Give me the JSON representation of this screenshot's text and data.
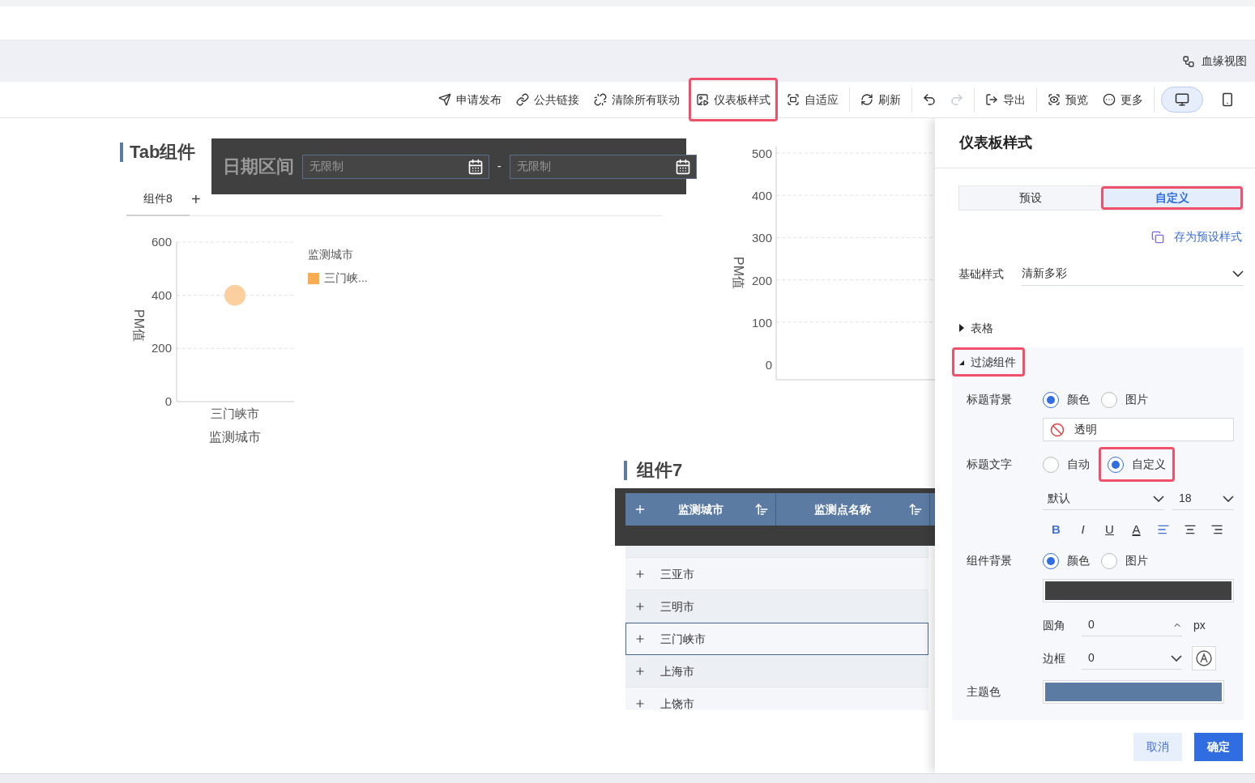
{
  "header": {
    "lineage_link": "血缘视图"
  },
  "toolbar": {
    "groups": [
      [
        {
          "kind": "send",
          "label": "申请发布",
          "highlighted": false
        },
        {
          "kind": "link",
          "label": "公共链接",
          "highlighted": false
        },
        {
          "kind": "unlink",
          "label": "清除所有联动",
          "highlighted": false
        },
        {
          "kind": "style",
          "label": "仪表板样式",
          "highlighted": true
        },
        {
          "kind": "fit",
          "label": "自适应",
          "highlighted": false
        }
      ],
      [
        {
          "kind": "refresh",
          "label": "刷新",
          "highlighted": false
        }
      ],
      [
        {
          "kind": "undo",
          "disabled": false
        },
        {
          "kind": "redo",
          "disabled": true
        }
      ],
      [
        {
          "kind": "export",
          "label": "导出",
          "highlighted": false
        }
      ],
      [
        {
          "kind": "preview",
          "label": "预览",
          "highlighted": false
        },
        {
          "kind": "more",
          "label": "更多",
          "highlighted": false
        }
      ]
    ],
    "devices": [
      {
        "kind": "desktop",
        "selected": true
      },
      {
        "kind": "mobile",
        "selected": false
      }
    ]
  },
  "tab_component": {
    "title": "Tab组件",
    "tabs": [
      {
        "label": "组件8",
        "selected": true
      }
    ],
    "add": "+",
    "chart": {
      "chart_data": {
        "type": "scatter",
        "xlabel": "监测城市",
        "ylabel": "PM值",
        "categories": [
          "三门峡市"
        ],
        "ylim": [
          0,
          600
        ],
        "yticks": [
          0,
          200,
          400,
          600
        ],
        "series": [
          {
            "color": "#fbd09e",
            "values": [
              400
            ]
          }
        ]
      }
    },
    "legend": {
      "title": "监测城市",
      "items": [
        {
          "label": "三门峡...",
          "color": "#f9ad50"
        }
      ]
    }
  },
  "date_filter": {
    "title": "日期区间",
    "start": {
      "placeholder": "无限制"
    },
    "separator": "-",
    "end": {
      "placeholder": "无限制"
    }
  },
  "empty_chart": {
    "axis_title": "PM值",
    "ticks": [
      "500",
      "400",
      "300",
      "200",
      "100",
      "0"
    ]
  },
  "table_component": {
    "title": "组件7",
    "columns": [
      {
        "label": "监测城市"
      },
      {
        "label": "监测点名称"
      }
    ],
    "rows": [
      {
        "city": "三亚市",
        "selected": false
      },
      {
        "city": "三明市",
        "selected": false
      },
      {
        "city": "三门峡市",
        "selected": true
      },
      {
        "city": "上海市",
        "selected": false
      },
      {
        "city": "上饶市",
        "selected": false
      }
    ]
  },
  "style_panel": {
    "title": "仪表板样式",
    "tabs": [
      {
        "label": "预设",
        "selected": false,
        "highlighted": false
      },
      {
        "label": "自定义",
        "selected": true,
        "highlighted": true
      }
    ],
    "save_preset": "存为预设样式",
    "base_style": {
      "label": "基础样式",
      "value": "清新多彩"
    },
    "sections": [
      {
        "label": "表格",
        "expanded": false,
        "highlighted": false
      },
      {
        "label": "过滤组件",
        "expanded": true,
        "highlighted": true
      }
    ],
    "title_background": {
      "label": "标题背景",
      "options": [
        {
          "label": "颜色",
          "selected": true
        },
        {
          "label": "图片",
          "selected": false
        }
      ],
      "fill": "透明"
    },
    "title_text": {
      "label": "标题文字",
      "options": [
        {
          "label": "自动",
          "selected": false,
          "highlighted": false
        },
        {
          "label": "自定义",
          "selected": true,
          "highlighted": true
        }
      ],
      "font": "默认",
      "size": "18",
      "format_buttons": [
        {
          "kind": "bold",
          "label": "B",
          "active": true
        },
        {
          "kind": "italic",
          "label": "I",
          "active": false
        },
        {
          "kind": "underline",
          "label": "U",
          "active": false
        },
        {
          "kind": "color",
          "label": "A",
          "active": false
        },
        {
          "kind": "align-left",
          "active": true
        },
        {
          "kind": "align-center",
          "active": false
        },
        {
          "kind": "align-right",
          "active": false
        }
      ]
    },
    "component_background": {
      "label": "组件背景",
      "options": [
        {
          "label": "颜色",
          "selected": true
        },
        {
          "label": "图片",
          "selected": false
        }
      ],
      "color": "#404040"
    },
    "corner": {
      "label": "圆角",
      "value": "0",
      "unit": "px"
    },
    "border": {
      "label": "边框",
      "value": "0"
    },
    "theme_color": {
      "label": "主题色",
      "color": "#5b7ba3"
    },
    "cancel": "取消",
    "confirm": "确定"
  }
}
